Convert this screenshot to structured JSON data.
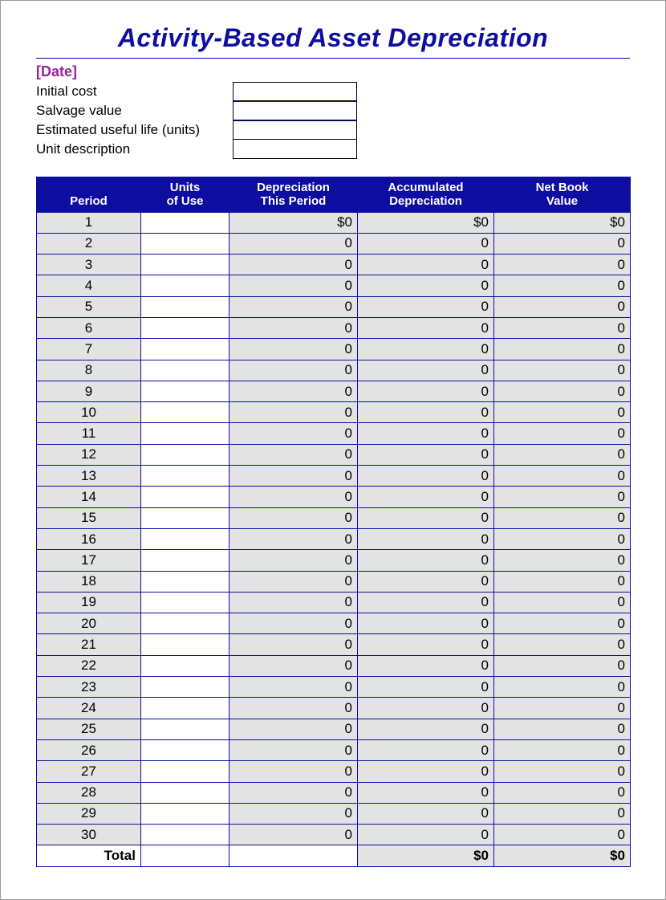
{
  "title": "Activity-Based Asset Depreciation",
  "date_placeholder": "[Date]",
  "meta": {
    "labels": {
      "initial_cost": "Initial cost",
      "salvage_value": "Salvage value",
      "est_life": "Estimated useful life (units)",
      "unit_desc": "Unit description"
    },
    "values": {
      "initial_cost": "",
      "salvage_value": "",
      "est_life": "",
      "unit_desc": ""
    }
  },
  "table": {
    "headers": {
      "period": "Period",
      "units_1": "Units",
      "units_2": "of Use",
      "dep_1": "Depreciation",
      "dep_2": "This Period",
      "accum_1": "Accumulated",
      "accum_2": "Depreciation",
      "net_1": "Net Book",
      "net_2": "Value"
    },
    "rows": [
      {
        "period": "1",
        "units": "",
        "dep": "$0",
        "accum": "$0",
        "net": "$0"
      },
      {
        "period": "2",
        "units": "",
        "dep": "0",
        "accum": "0",
        "net": "0"
      },
      {
        "period": "3",
        "units": "",
        "dep": "0",
        "accum": "0",
        "net": "0"
      },
      {
        "period": "4",
        "units": "",
        "dep": "0",
        "accum": "0",
        "net": "0"
      },
      {
        "period": "5",
        "units": "",
        "dep": "0",
        "accum": "0",
        "net": "0"
      },
      {
        "period": "6",
        "units": "",
        "dep": "0",
        "accum": "0",
        "net": "0"
      },
      {
        "period": "7",
        "units": "",
        "dep": "0",
        "accum": "0",
        "net": "0"
      },
      {
        "period": "8",
        "units": "",
        "dep": "0",
        "accum": "0",
        "net": "0"
      },
      {
        "period": "9",
        "units": "",
        "dep": "0",
        "accum": "0",
        "net": "0"
      },
      {
        "period": "10",
        "units": "",
        "dep": "0",
        "accum": "0",
        "net": "0"
      },
      {
        "period": "11",
        "units": "",
        "dep": "0",
        "accum": "0",
        "net": "0"
      },
      {
        "period": "12",
        "units": "",
        "dep": "0",
        "accum": "0",
        "net": "0"
      },
      {
        "period": "13",
        "units": "",
        "dep": "0",
        "accum": "0",
        "net": "0"
      },
      {
        "period": "14",
        "units": "",
        "dep": "0",
        "accum": "0",
        "net": "0"
      },
      {
        "period": "15",
        "units": "",
        "dep": "0",
        "accum": "0",
        "net": "0"
      },
      {
        "period": "16",
        "units": "",
        "dep": "0",
        "accum": "0",
        "net": "0"
      },
      {
        "period": "17",
        "units": "",
        "dep": "0",
        "accum": "0",
        "net": "0"
      },
      {
        "period": "18",
        "units": "",
        "dep": "0",
        "accum": "0",
        "net": "0"
      },
      {
        "period": "19",
        "units": "",
        "dep": "0",
        "accum": "0",
        "net": "0"
      },
      {
        "period": "20",
        "units": "",
        "dep": "0",
        "accum": "0",
        "net": "0"
      },
      {
        "period": "21",
        "units": "",
        "dep": "0",
        "accum": "0",
        "net": "0"
      },
      {
        "period": "22",
        "units": "",
        "dep": "0",
        "accum": "0",
        "net": "0"
      },
      {
        "period": "23",
        "units": "",
        "dep": "0",
        "accum": "0",
        "net": "0"
      },
      {
        "period": "24",
        "units": "",
        "dep": "0",
        "accum": "0",
        "net": "0"
      },
      {
        "period": "25",
        "units": "",
        "dep": "0",
        "accum": "0",
        "net": "0"
      },
      {
        "period": "26",
        "units": "",
        "dep": "0",
        "accum": "0",
        "net": "0"
      },
      {
        "period": "27",
        "units": "",
        "dep": "0",
        "accum": "0",
        "net": "0"
      },
      {
        "period": "28",
        "units": "",
        "dep": "0",
        "accum": "0",
        "net": "0"
      },
      {
        "period": "29",
        "units": "",
        "dep": "0",
        "accum": "0",
        "net": "0"
      },
      {
        "period": "30",
        "units": "",
        "dep": "0",
        "accum": "0",
        "net": "0"
      }
    ],
    "total": {
      "label": "Total",
      "units": "",
      "dep": "",
      "accum": "$0",
      "net": "$0"
    }
  }
}
